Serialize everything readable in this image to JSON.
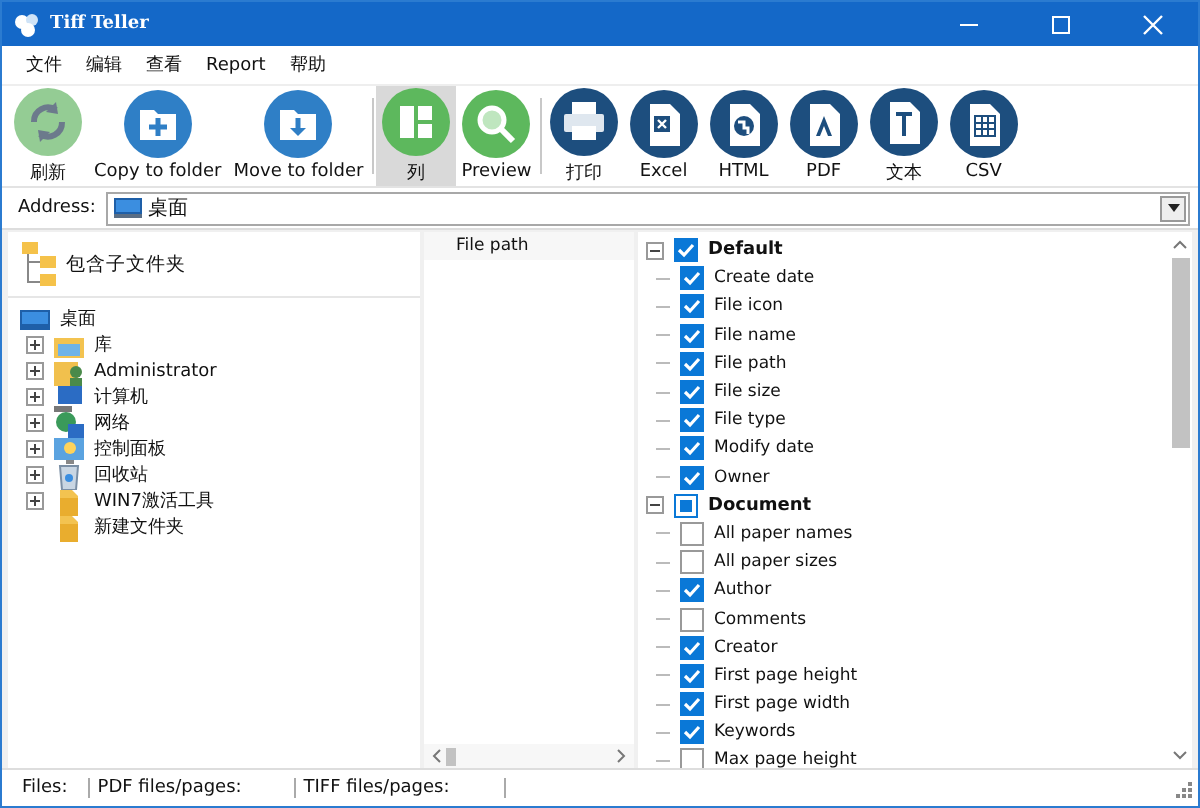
{
  "window": {
    "title": "Tiff Teller"
  },
  "menu": [
    "文件",
    "编辑",
    "查看",
    "Report",
    "帮助"
  ],
  "toolbar": [
    [
      {
        "label": "刷新",
        "kind": "refresh",
        "color": "#94cc94",
        "selected": false
      },
      {
        "label": "Copy to folder",
        "kind": "folder-plus",
        "color": "#2f7fc6",
        "selected": false
      },
      {
        "label": "Move to folder",
        "kind": "folder-down",
        "color": "#2f7fc6",
        "selected": false
      }
    ],
    [
      {
        "label": "列",
        "kind": "columns",
        "color": "#5db85d",
        "selected": true
      },
      {
        "label": "Preview",
        "kind": "magnifier",
        "color": "#5db85d",
        "selected": false
      }
    ],
    [
      {
        "label": "打印",
        "kind": "printer",
        "color": "#1d4e7e",
        "selected": false
      },
      {
        "label": "Excel",
        "kind": "excel",
        "color": "#1d4e7e",
        "selected": false
      },
      {
        "label": "HTML",
        "kind": "globe",
        "color": "#1d4e7e",
        "selected": false
      },
      {
        "label": "PDF",
        "kind": "pdf",
        "color": "#1d4e7e",
        "selected": false
      },
      {
        "label": "文本",
        "kind": "text",
        "color": "#1d4e7e",
        "selected": false
      },
      {
        "label": "CSV",
        "kind": "grid",
        "color": "#1d4e7e",
        "selected": false
      }
    ]
  ],
  "address": {
    "label": "Address:",
    "value": "桌面"
  },
  "folders": {
    "include_subfolders": "包含子文件夹",
    "tree": [
      {
        "label": "桌面",
        "kind": "desktop",
        "children": [
          {
            "label": "库",
            "kind": "library",
            "expandable": true
          },
          {
            "label": "Administrator",
            "kind": "user",
            "expandable": true
          },
          {
            "label": "计算机",
            "kind": "computer",
            "expandable": true
          },
          {
            "label": "网络",
            "kind": "network",
            "expandable": true
          },
          {
            "label": "控制面板",
            "kind": "control",
            "expandable": true
          },
          {
            "label": "回收站",
            "kind": "bin",
            "expandable": true
          },
          {
            "label": "WIN7激活工具",
            "kind": "folder",
            "expandable": true
          },
          {
            "label": "新建文件夹",
            "kind": "folder",
            "expandable": false
          }
        ]
      }
    ]
  },
  "files": {
    "columns": [
      "File path"
    ]
  },
  "fields": [
    {
      "label": "Default",
      "checked": true,
      "partial": false,
      "expanded": true,
      "children": [
        {
          "label": "Create date",
          "checked": true
        },
        {
          "label": "File icon",
          "checked": true
        },
        {
          "label": "File name",
          "checked": true
        },
        {
          "label": "File path",
          "checked": true
        },
        {
          "label": "File size",
          "checked": true
        },
        {
          "label": "File type",
          "checked": true
        },
        {
          "label": "Modify date",
          "checked": true
        },
        {
          "label": "Owner",
          "checked": true
        }
      ]
    },
    {
      "label": "Document",
      "checked": false,
      "partial": true,
      "expanded": true,
      "children": [
        {
          "label": "All paper names",
          "checked": false
        },
        {
          "label": "All paper sizes",
          "checked": false
        },
        {
          "label": "Author",
          "checked": true
        },
        {
          "label": "Comments",
          "checked": false
        },
        {
          "label": "Creator",
          "checked": true
        },
        {
          "label": "First page height",
          "checked": true
        },
        {
          "label": "First page width",
          "checked": true
        },
        {
          "label": "Keywords",
          "checked": true
        },
        {
          "label": "Max page height",
          "checked": false
        }
      ]
    }
  ],
  "status_bar": [
    "Files:",
    "PDF files/pages:",
    "TIFF files/pages:"
  ]
}
